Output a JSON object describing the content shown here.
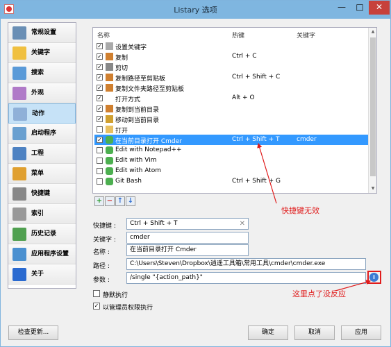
{
  "window": {
    "title": "Listary 选项",
    "minimize": "—",
    "maximize": "□",
    "close": "✕"
  },
  "sidebar": {
    "items": [
      {
        "label": "常规设置",
        "icon": "settings-icon",
        "color": "#6a8fb5"
      },
      {
        "label": "关键字",
        "icon": "abc-icon",
        "color": "#f0c040"
      },
      {
        "label": "搜索",
        "icon": "magnifier-icon",
        "color": "#5a9ad8"
      },
      {
        "label": "外观",
        "icon": "palette-icon",
        "color": "#b07ac8"
      },
      {
        "label": "动作",
        "icon": "actions-icon",
        "color": "#8fb0d8"
      },
      {
        "label": "启动程序",
        "icon": "launch-icon",
        "color": "#6aa0d0"
      },
      {
        "label": "工程",
        "icon": "project-icon",
        "color": "#4e82c2"
      },
      {
        "label": "菜单",
        "icon": "folder-heart-icon",
        "color": "#e0a030"
      },
      {
        "label": "快捷键",
        "icon": "keyboard-icon",
        "color": "#888888"
      },
      {
        "label": "索引",
        "icon": "index-icon",
        "color": "#999999"
      },
      {
        "label": "历史记录",
        "icon": "clock-icon",
        "color": "#50a050"
      },
      {
        "label": "应用程序设置",
        "icon": "apps-icon",
        "color": "#4a90d0"
      },
      {
        "label": "关于",
        "icon": "info-icon",
        "color": "#2a6ad0"
      }
    ],
    "selected_index": 4
  },
  "list": {
    "columns": {
      "name": "名称",
      "hotkey": "热键",
      "keyword": "关键字"
    },
    "rows": [
      {
        "checked": true,
        "icon": "keyword-icon",
        "name": "设置关键字",
        "hotkey": "",
        "keyword": ""
      },
      {
        "checked": true,
        "icon": "copy-icon",
        "name": "复制",
        "hotkey": "Ctrl + C",
        "keyword": ""
      },
      {
        "checked": true,
        "icon": "cut-icon",
        "name": "剪切",
        "hotkey": "",
        "keyword": ""
      },
      {
        "checked": true,
        "icon": "copy-path-icon",
        "name": "复制路径至剪贴板",
        "hotkey": "Ctrl + Shift + C",
        "keyword": ""
      },
      {
        "checked": true,
        "icon": "copy-folder-icon",
        "name": "复制文件夹路径至剪贴板",
        "hotkey": "",
        "keyword": ""
      },
      {
        "checked": true,
        "icon": "",
        "name": "打开方式",
        "hotkey": "Alt + O",
        "keyword": ""
      },
      {
        "checked": true,
        "icon": "copy-to-icon",
        "name": "复制到当前目录",
        "hotkey": "",
        "keyword": ""
      },
      {
        "checked": true,
        "icon": "move-to-icon",
        "name": "移动到当前目录",
        "hotkey": "",
        "keyword": ""
      },
      {
        "checked": false,
        "icon": "open-folder-icon",
        "name": "打开",
        "hotkey": "",
        "keyword": ""
      },
      {
        "checked": true,
        "icon": "puzzle-icon",
        "name": "在当前目录打开 Cmder",
        "hotkey": "Ctrl + Shift + T",
        "keyword": "cmder"
      },
      {
        "checked": false,
        "icon": "puzzle-icon",
        "name": "Edit with Notepad++",
        "hotkey": "",
        "keyword": ""
      },
      {
        "checked": false,
        "icon": "puzzle-icon",
        "name": "Edit with Vim",
        "hotkey": "",
        "keyword": ""
      },
      {
        "checked": false,
        "icon": "puzzle-icon",
        "name": "Edit with Atom",
        "hotkey": "",
        "keyword": ""
      },
      {
        "checked": false,
        "icon": "puzzle-icon",
        "name": "Git Bash",
        "hotkey": "Ctrl + Shift + G",
        "keyword": ""
      }
    ],
    "selected_index": 9,
    "checkmark": "✓",
    "tools": {
      "add": "+",
      "remove": "−",
      "up": "↑",
      "down": "↓"
    }
  },
  "form": {
    "hotkey_label": "快捷键 :",
    "hotkey_value": "Ctrl + Shift + T",
    "keyword_label": "关键字 :",
    "keyword_value": "cmder",
    "name_label": "名称 :",
    "name_value": "在当前目录打开 Cmder",
    "path_label": "路径 :",
    "path_value": "C:\\Users\\Steven\\Dropbox\\逍遥工具箱\\常用工具\\cmder\\cmder.exe",
    "args_label": "参数 :",
    "args_value": "/single \"{action_path}\"",
    "info_symbol": "i",
    "clear_symbol": "✕",
    "silent_label": "静默执行",
    "silent_checked": false,
    "admin_label": "以管理员权限执行",
    "admin_checked": true
  },
  "annotations": {
    "hotkey_invalid": "快捷键无效",
    "no_response": "这里点了没反应",
    "color": "#e01c1c"
  },
  "buttons": {
    "check_update": "检查更新...",
    "ok": "确定",
    "cancel": "取消",
    "apply": "应用"
  }
}
